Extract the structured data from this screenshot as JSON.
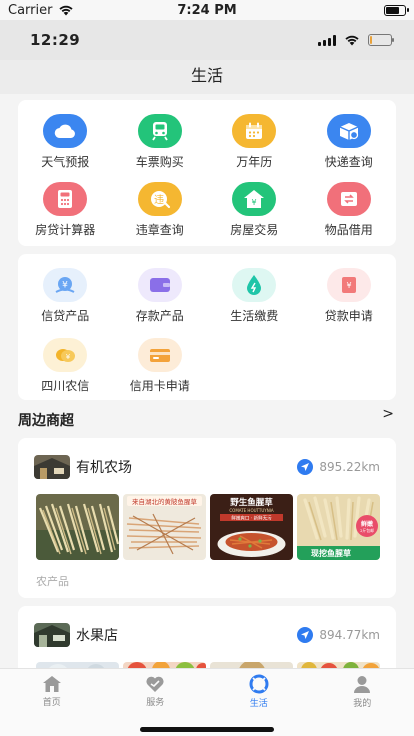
{
  "device_status": {
    "carrier": "Carrier",
    "time": "7:24 PM"
  },
  "app_status": {
    "time": "12:29"
  },
  "nav": {
    "title": "生活"
  },
  "services_primary": [
    {
      "label": "天气预报",
      "icon": "cloud-icon",
      "color": "#3b86f0"
    },
    {
      "label": "车票购买",
      "icon": "train-icon",
      "color": "#23c47a"
    },
    {
      "label": "万年历",
      "icon": "calendar-icon",
      "color": "#f5b731"
    },
    {
      "label": "快递查询",
      "icon": "package-icon",
      "color": "#3b86f0"
    },
    {
      "label": "房贷计算器",
      "icon": "calculator-icon",
      "color": "#f1707a"
    },
    {
      "label": "违章查询",
      "icon": "violation-icon",
      "color": "#f5b731"
    },
    {
      "label": "房屋交易",
      "icon": "house-icon",
      "color": "#23c47a"
    },
    {
      "label": "物品借用",
      "icon": "borrow-icon",
      "color": "#f1707a"
    }
  ],
  "services_finance": [
    {
      "label": "信贷产品",
      "icon": "credit-icon",
      "color": "#5a9cf2"
    },
    {
      "label": "存款产品",
      "icon": "wallet-icon",
      "color": "#8a6fe8"
    },
    {
      "label": "生活缴费",
      "icon": "water-drop-icon",
      "color": "#1fc5a8"
    },
    {
      "label": "贷款申请",
      "icon": "loan-form-icon",
      "color": "#f27a7a"
    },
    {
      "label": "四川农信",
      "icon": "coins-icon",
      "color": "#f3b42a"
    },
    {
      "label": "信用卡申请",
      "icon": "credit-card-icon",
      "color": "#f3a23a"
    }
  ],
  "nearby": {
    "title": "周边商超",
    "arrow": ">",
    "shops": [
      {
        "name": "有机农场",
        "distance": "895.22km",
        "category": "农产品"
      },
      {
        "name": "水果店",
        "distance": "894.77km",
        "category": ""
      }
    ],
    "thumb_texts": {
      "t2_banner": "来自湖北的黄陂鱼腥草",
      "t3_title": "野生鱼腥草",
      "t3_sub": "COMATE HOUTTUYNIA",
      "t3_tag": "鲜嫩爽口 · 新鲜无污",
      "t4_badge": "鲜嫩",
      "t4_badge_sub": "2斤包邮",
      "t4_caption": "现挖鱼腥草"
    }
  },
  "tabbar": [
    {
      "label": "首页",
      "icon": "home-icon",
      "active": false
    },
    {
      "label": "服务",
      "icon": "heart-icon",
      "active": false
    },
    {
      "label": "生活",
      "icon": "life-ring-icon",
      "active": true
    },
    {
      "label": "我的",
      "icon": "user-icon",
      "active": false
    }
  ]
}
